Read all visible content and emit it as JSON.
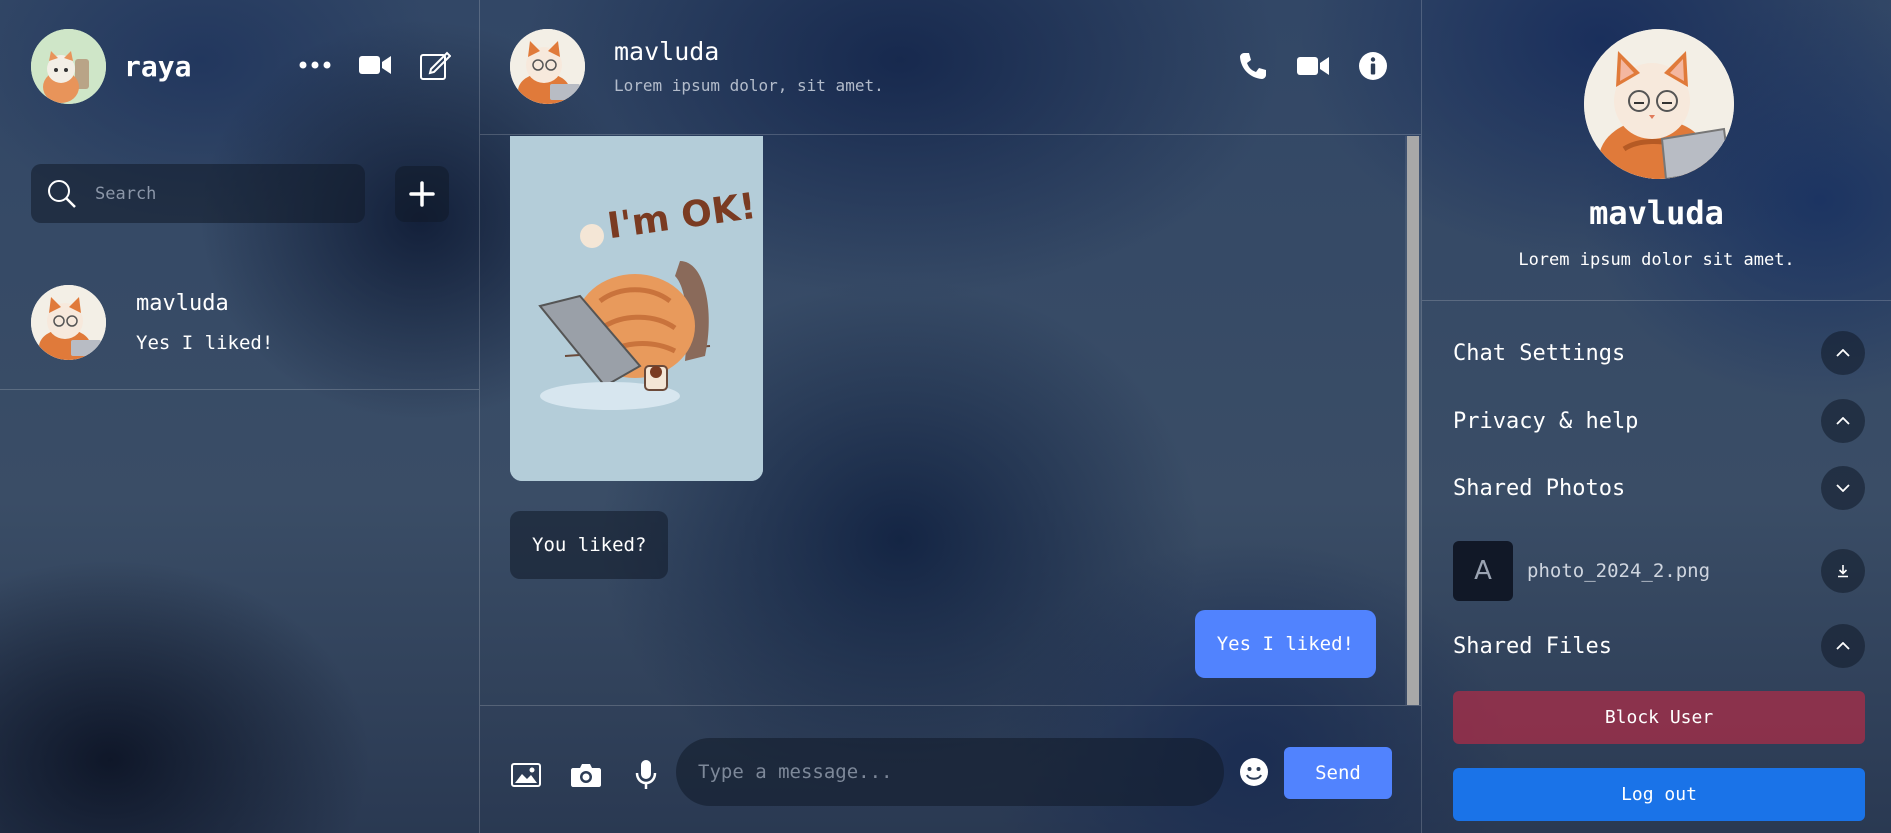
{
  "colors": {
    "accent": "#5183fe",
    "danger": "#af2d46",
    "logout": "#1a73e8"
  },
  "current_user": {
    "name": "raya",
    "avatar_icon": "cat-avatar-icon"
  },
  "left_header_icons": [
    "more-icon",
    "video-icon",
    "edit-icon"
  ],
  "search": {
    "placeholder": "Search",
    "value": ""
  },
  "chat_list": [
    {
      "name": "mavluda",
      "last_message": "Yes I liked!"
    }
  ],
  "chat": {
    "name": "mavluda",
    "status": "Lorem ipsum dolor, sit amet.",
    "header_icons": [
      "phone-icon",
      "video-icon",
      "info-icon"
    ],
    "messages": [
      {
        "type": "sticker",
        "direction": "in",
        "sticker_text": "I'm OK!"
      },
      {
        "type": "text",
        "direction": "in",
        "text": "You liked?"
      },
      {
        "type": "text",
        "direction": "out",
        "text": "Yes I liked!"
      }
    ]
  },
  "composer": {
    "placeholder": "Type a message...",
    "value": "",
    "send_label": "Send",
    "icons": [
      "image-icon",
      "camera-icon",
      "microphone-icon",
      "emoji-icon"
    ]
  },
  "details": {
    "name": "mavluda",
    "bio": "Lorem ipsum dolor sit amet.",
    "sections": [
      {
        "title": "Chat Settings",
        "chevron": "up"
      },
      {
        "title": "Privacy & help",
        "chevron": "up"
      },
      {
        "title": "Shared Photos",
        "chevron": "down"
      },
      {
        "title": "Shared Files",
        "chevron": "up"
      }
    ],
    "shared_photos": [
      {
        "thumb_letter": "A",
        "filename": "photo_2024_2.png"
      }
    ],
    "block_label": "Block User",
    "logout_label": "Log out"
  }
}
